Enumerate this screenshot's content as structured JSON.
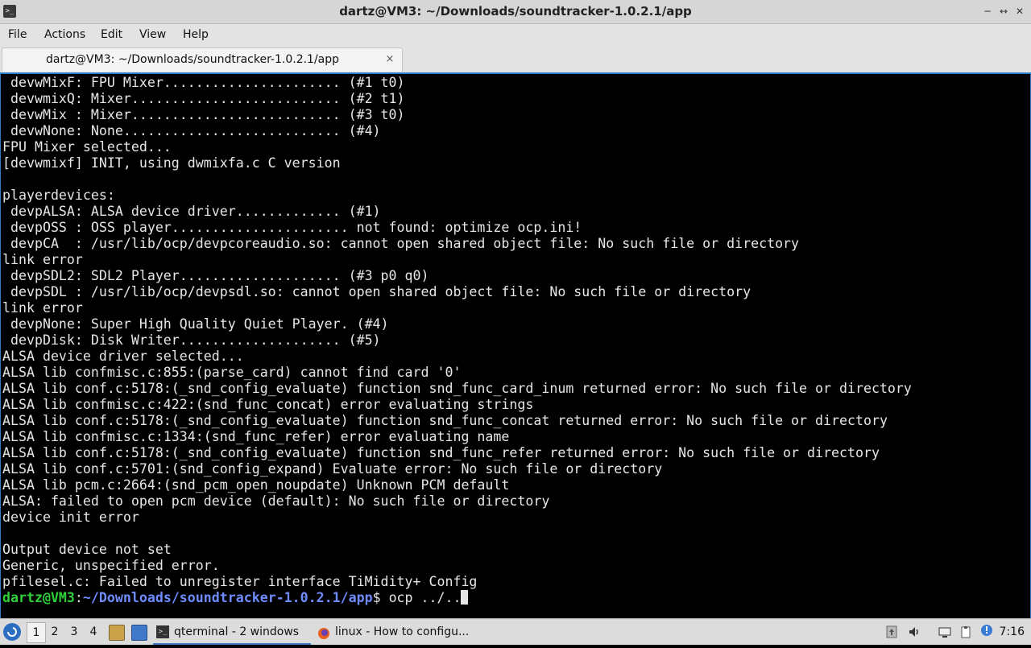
{
  "window": {
    "app_icon": "terminal-icon",
    "title": "dartz@VM3: ~/Downloads/soundtracker-1.0.2.1/app",
    "controls": [
      "minimize-icon",
      "maximize-icon",
      "close-icon"
    ]
  },
  "menu": [
    "File",
    "Actions",
    "Edit",
    "View",
    "Help"
  ],
  "tab": {
    "label": "dartz@VM3: ~/Downloads/soundtracker-1.0.2.1/app",
    "close_glyph": "×"
  },
  "terminal": {
    "lines": [
      " devwMixF: FPU Mixer...................... (#1 t0)",
      " devwmixQ: Mixer.......................... (#2 t1)",
      " devwMix : Mixer.......................... (#3 t0)",
      " devwNone: None........................... (#4)",
      "FPU Mixer selected...",
      "[devwmixf] INIT, using dwmixfa.c C version",
      "",
      "playerdevices:",
      " devpALSA: ALSA device driver............. (#1)",
      " devpOSS : OSS player...................... not found: optimize ocp.ini!",
      " devpCA  : /usr/lib/ocp/devpcoreaudio.so: cannot open shared object file: No such file or directory",
      "link error",
      " devpSDL2: SDL2 Player.................... (#3 p0 q0)",
      " devpSDL : /usr/lib/ocp/devpsdl.so: cannot open shared object file: No such file or directory",
      "link error",
      " devpNone: Super High Quality Quiet Player. (#4)",
      " devpDisk: Disk Writer.................... (#5)",
      "ALSA device driver selected...",
      "ALSA lib confmisc.c:855:(parse_card) cannot find card '0'",
      "ALSA lib conf.c:5178:(_snd_config_evaluate) function snd_func_card_inum returned error: No such file or directory",
      "ALSA lib confmisc.c:422:(snd_func_concat) error evaluating strings",
      "ALSA lib conf.c:5178:(_snd_config_evaluate) function snd_func_concat returned error: No such file or directory",
      "ALSA lib confmisc.c:1334:(snd_func_refer) error evaluating name",
      "ALSA lib conf.c:5178:(_snd_config_evaluate) function snd_func_refer returned error: No such file or directory",
      "ALSA lib conf.c:5701:(snd_config_expand) Evaluate error: No such file or directory",
      "ALSA lib pcm.c:2664:(snd_pcm_open_noupdate) Unknown PCM default",
      "ALSA: failed to open pcm device (default): No such file or directory",
      "device init error",
      "",
      "Output device not set",
      "Generic, unspecified error.",
      "pfilesel.c: Failed to unregister interface TiMidity+ Config"
    ],
    "prompt": {
      "user_host": "dartz@VM3",
      "sep": ":",
      "path": "~/Downloads/soundtracker-1.0.2.1/app",
      "symbol": "$ ",
      "command": "ocp ../.."
    },
    "colors": {
      "user": "#2fd23a",
      "path": "#6f8cff",
      "text": "#e6e6e6",
      "background": "#000000"
    }
  },
  "taskbar": {
    "start_icon": "lxqt-start-icon",
    "workspaces": [
      "1",
      "2",
      "3",
      "4"
    ],
    "active_workspace": "1",
    "quicklaunch": [
      "file-manager-icon",
      "desktop-icon"
    ],
    "tasks": [
      {
        "icon": "terminal-icon",
        "label": "qterminal - 2 windows"
      },
      {
        "icon": "firefox-icon",
        "label": "linux - How to configu..."
      }
    ],
    "tray": [
      "update-icon",
      "volume-icon",
      "network-icon",
      "clipboard-icon",
      "notification-icon"
    ],
    "clock": "7:16"
  }
}
